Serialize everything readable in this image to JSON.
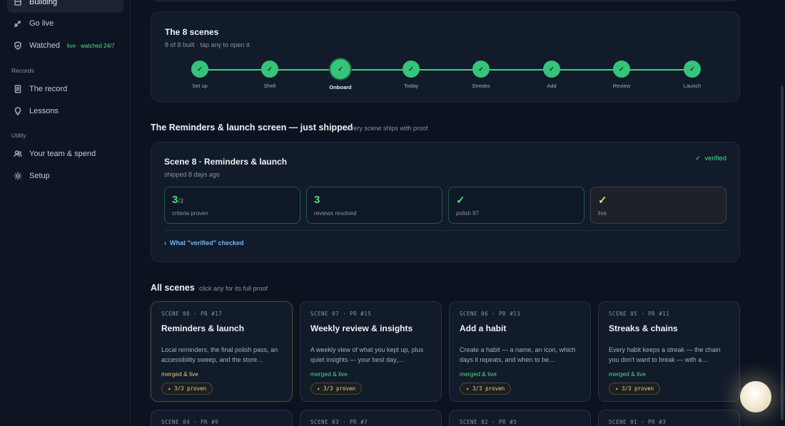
{
  "sidebar": {
    "items": [
      {
        "label": "Building",
        "icon": "box-icon"
      },
      {
        "label": "Go live",
        "icon": "rocket-icon"
      },
      {
        "label": "Watched",
        "icon": "shield-icon",
        "sub": "live · watched 24/7"
      }
    ],
    "records_label": "Records",
    "records": [
      {
        "label": "The record",
        "icon": "document-icon"
      },
      {
        "label": "Lessons",
        "icon": "lightbulb-icon"
      }
    ],
    "utility_label": "Utility",
    "utility": [
      {
        "label": "Your team & spend",
        "icon": "users-icon"
      },
      {
        "label": "Setup",
        "icon": "gear-icon"
      }
    ]
  },
  "scenes_overview": {
    "title": "The 8 scenes",
    "subtitle": "8 of 8 built · tap any to open it",
    "steps": [
      "Set up",
      "Shell",
      "Onboard",
      "Today",
      "Streaks",
      "Add",
      "Review",
      "Launch"
    ],
    "check": "✓"
  },
  "shipped": {
    "heading": "The Reminders & launch screen — just shipped",
    "heading_sub": "every scene ships with proof",
    "title": "Scene 8 · Reminders & launch",
    "subtitle": "shipped 8 days ago",
    "verified": "verified",
    "stats": [
      {
        "value": "3",
        "suffix": "/3",
        "caption": "criteria proven"
      },
      {
        "value": "3",
        "suffix": "",
        "caption": "reviews resolved"
      },
      {
        "value": "✓",
        "suffix": "",
        "caption": "polish 97"
      },
      {
        "value": "✓",
        "suffix": "",
        "caption": "live"
      }
    ],
    "link": "What \"verified\" checked"
  },
  "all_scenes": {
    "heading": "All scenes",
    "heading_sub": "click any for its full proof",
    "cards": [
      {
        "meta": "SCENE 08 · PR #17",
        "title": "Reminders & launch",
        "desc": "Local reminders, the final polish pass, an accessibility sweep, and the store…",
        "status": "merged & live",
        "pill": "✦ 3/3 proven"
      },
      {
        "meta": "SCENE 07 · PR #15",
        "title": "Weekly review & insights",
        "desc": "A weekly view of what you kept up, plus quiet insights — your best day,…",
        "status": "merged & live",
        "pill": "✦ 3/3 proven"
      },
      {
        "meta": "SCENE 06 · PR #13",
        "title": "Add a habit",
        "desc": "Create a habit — a name, an icon, which days it repeats, and when to be…",
        "status": "merged & live",
        "pill": "✦ 3/3 proven"
      },
      {
        "meta": "SCENE 05 · PR #11",
        "title": "Streaks & chains",
        "desc": "Every habit keeps a streak — the chain you don't want to break — with a…",
        "status": "merged & live",
        "pill": "✦ 3/3 proven"
      }
    ],
    "next_row": [
      "SCENE 04 · PR #9",
      "SCENE 03 · PR #7",
      "SCENE 02 · PR #5",
      "SCENE 01 · PR #3"
    ]
  }
}
